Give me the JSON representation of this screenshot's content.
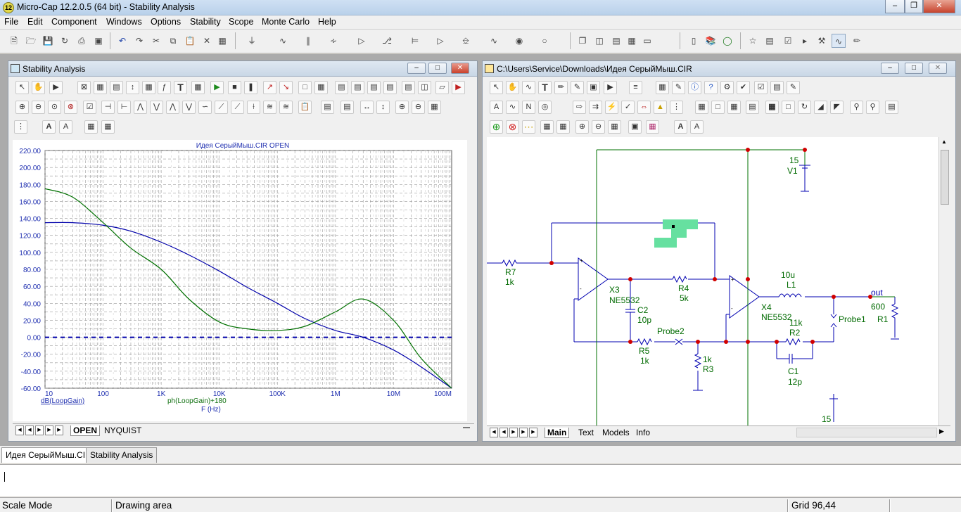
{
  "app": {
    "title": "Micro-Cap 12.2.0.5 (64 bit) - Stability Analysis",
    "icon_label": "12"
  },
  "menu": [
    "File",
    "Edit",
    "Component",
    "Windows",
    "Options",
    "Stability",
    "Scope",
    "Monte Carlo",
    "Help"
  ],
  "stability_window": {
    "title": "Stability Analysis",
    "plot_title": "Идея СерыйМыш.CIR OPEN",
    "y_ticks": [
      "220.00",
      "200.00",
      "180.00",
      "160.00",
      "140.00",
      "120.00",
      "100.00",
      "80.00",
      "60.00",
      "40.00",
      "20.00",
      "0.00",
      "-20.00",
      "-40.00",
      "-60.00"
    ],
    "x_ticks": [
      "10",
      "100",
      "1K",
      "10K",
      "100K",
      "1M",
      "10M",
      "100M"
    ],
    "legend_gain": "dB(LoopGain)",
    "legend_phase": "ph(LoopGain)+180",
    "x_axis_label": "F (Hz)",
    "tabs": [
      "OPEN",
      "NYQUIST"
    ]
  },
  "chart_data": {
    "type": "line",
    "title": "Идея СерыйМыш.CIR OPEN",
    "xlabel": "F (Hz)",
    "x_scale": "log",
    "xlim": [
      10,
      100000000
    ],
    "ylim": [
      -60,
      220
    ],
    "grid": true,
    "series": [
      {
        "name": "dB(LoopGain)",
        "color": "#0000aa",
        "x": [
          10,
          30,
          100,
          300,
          1000,
          3000,
          10000,
          30000,
          100000,
          300000,
          1000000,
          3000000,
          10000000,
          30000000,
          100000000
        ],
        "y": [
          135,
          135,
          132,
          125,
          112,
          97,
          78,
          59,
          40,
          22,
          8,
          0,
          -15,
          -35,
          -62
        ]
      },
      {
        "name": "ph(LoopGain)+180",
        "color": "#007000",
        "x": [
          10,
          30,
          100,
          300,
          1000,
          3000,
          10000,
          30000,
          100000,
          300000,
          1000000,
          3000000,
          10000000,
          30000000,
          100000000
        ],
        "y": [
          175,
          165,
          135,
          105,
          80,
          45,
          18,
          10,
          8,
          13,
          30,
          45,
          20,
          -25,
          -62
        ]
      },
      {
        "name": "0 dB reference",
        "color": "#0000aa",
        "x": [
          10,
          100000000
        ],
        "y": [
          0,
          0
        ]
      }
    ]
  },
  "schematic_window": {
    "title": "C:\\Users\\Service\\Downloads\\Идея СерыйМыш.CIR",
    "tabs": [
      "Main",
      "Text",
      "Models",
      "Info"
    ],
    "labels": {
      "v1_value": "15",
      "v1_name": "V1",
      "r7_name": "R7",
      "r7_value": "1k",
      "x3_name": "X3",
      "x3_model": "NE5532",
      "c2_name": "C2",
      "c2_value": "10p",
      "r4_name": "R4",
      "r4_value": "5k",
      "x4_name": "X4",
      "x4_model": "NE5532",
      "l1_value": "10u",
      "l1_name": "L1",
      "out": "out",
      "r1_value": "600",
      "r1_name": "R1",
      "probe1": "Probe1",
      "probe2": "Probe2",
      "r5_name": "R5",
      "r5_value": "1k",
      "r3_value": "1k",
      "r3_name": "R3",
      "r2_value": "11k",
      "r2_name": "R2",
      "c1_name": "C1",
      "c1_value": "12p",
      "v2_value": "15"
    }
  },
  "doc_tabs": [
    "Идея СерыйМыш.CIR",
    "Stability Analysis"
  ],
  "status": {
    "mode": "Scale Mode",
    "area": "Drawing area",
    "grid": "Grid 96,44"
  }
}
